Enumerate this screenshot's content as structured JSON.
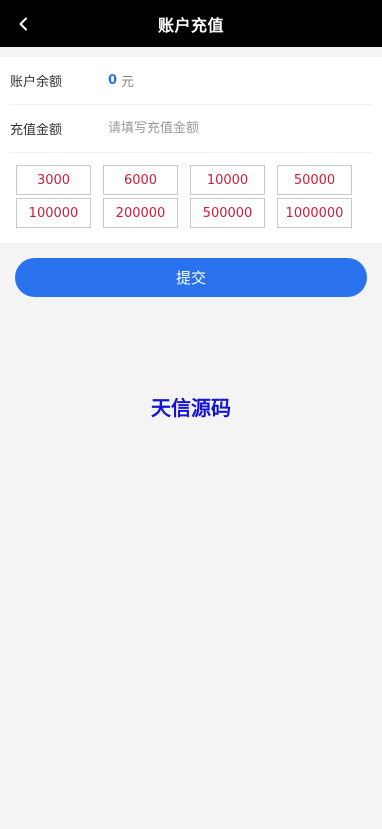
{
  "header": {
    "title": "账户充值",
    "back_icon": "chevron-left-icon"
  },
  "balance": {
    "label": "账户余额",
    "value": "0",
    "unit": "元"
  },
  "recharge": {
    "label": "充值金额",
    "placeholder": "请填写充值金额"
  },
  "amount_options": [
    "3000",
    "6000",
    "10000",
    "50000",
    "100000",
    "200000",
    "500000",
    "1000000"
  ],
  "submit_label": "提交",
  "watermark": "天信源码",
  "colors": {
    "header_bg": "#000000",
    "accent": "#2a72ed",
    "amount_text": "#c9203a",
    "watermark": "#1414d2",
    "page_bg": "#f4f4f4"
  }
}
